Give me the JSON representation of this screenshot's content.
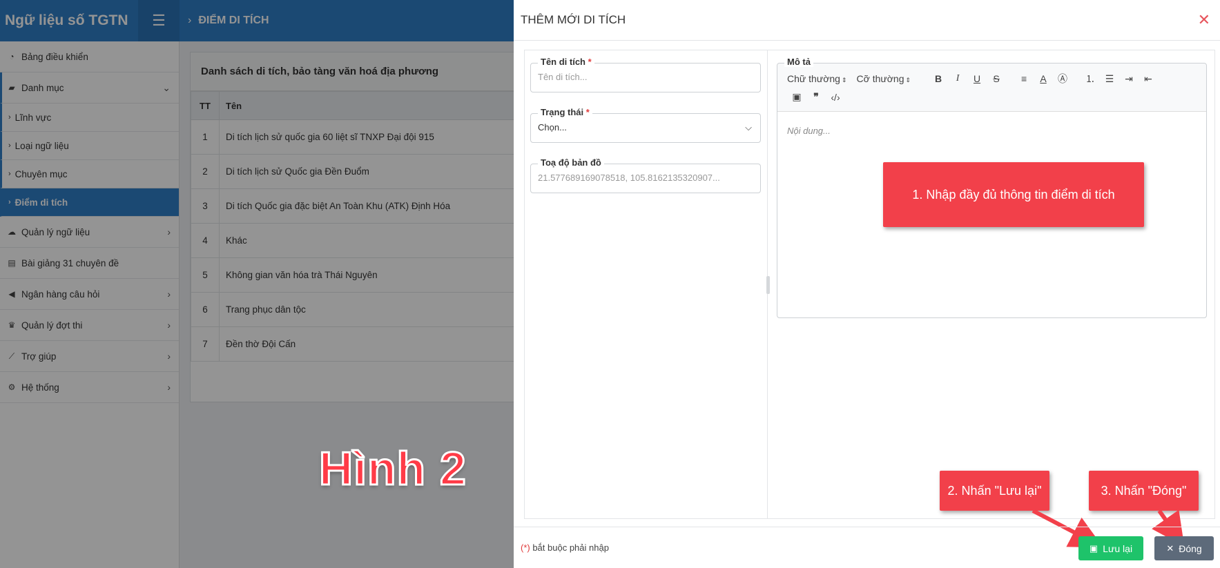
{
  "app": {
    "brand": "Ngữ liệu số TGTN",
    "page_title": "ĐIỂM DI TÍCH"
  },
  "sidebar": {
    "items": [
      {
        "label": "Bảng điều khiển",
        "icon": "dashboard-icon"
      },
      {
        "label": "Danh mục",
        "icon": "folder-open-icon"
      },
      {
        "label": "Lĩnh vực"
      },
      {
        "label": "Loại ngữ liệu"
      },
      {
        "label": "Chuyên mục"
      },
      {
        "label": "Điểm di tích"
      },
      {
        "label": "Quản lý ngữ liệu",
        "icon": "cloud-icon"
      },
      {
        "label": "Bài giảng 31 chuyên đề",
        "icon": "archive-icon"
      },
      {
        "label": "Ngân hàng câu hỏi",
        "icon": "bullhorn-icon"
      },
      {
        "label": "Quản lý đợt thi",
        "icon": "trophy-icon"
      },
      {
        "label": "Trợ giúp",
        "icon": "chart-line-icon"
      },
      {
        "label": "Hệ thống",
        "icon": "gears-icon"
      }
    ]
  },
  "list": {
    "title": "Danh sách di tích, bảo tàng văn hoá địa phương",
    "columns": [
      "TT",
      "Tên"
    ],
    "rows": [
      {
        "tt": "1",
        "name": "Di tích lịch sử quốc gia 60 liệt sĩ TNXP Đại đội 915"
      },
      {
        "tt": "2",
        "name": "Di tích lịch sử Quốc gia Đền Đuổm"
      },
      {
        "tt": "3",
        "name": "Di tích Quốc gia đặc biệt An Toàn Khu (ATK) Định Hóa"
      },
      {
        "tt": "4",
        "name": "Khác"
      },
      {
        "tt": "5",
        "name": "Không gian văn hóa trà Thái Nguyên"
      },
      {
        "tt": "6",
        "name": "Trang phục dân tộc"
      },
      {
        "tt": "7",
        "name": "Đền thờ Đội Cấn"
      }
    ]
  },
  "overlay_label": "Hình 2",
  "drawer": {
    "title": "THÊM MỚI DI TÍCH",
    "fields": {
      "name": {
        "label": "Tên di tích",
        "required": "*",
        "placeholder": "Tên di tích..."
      },
      "status": {
        "label": "Trạng thái",
        "required": "*",
        "value": "Chọn..."
      },
      "coords": {
        "label": "Toạ độ bản đồ",
        "value": "21.577689169078518, 105.8162135320907..."
      },
      "description": {
        "label": "Mô tả",
        "placeholder": "Nội dung..."
      }
    },
    "toolbar": {
      "style_select": "Chữ thường",
      "size_select": "Cỡ thường"
    },
    "footer_note_mark": "(*)",
    "footer_note": " bắt buộc phải nhập",
    "save_label": "Lưu lại",
    "close_label": "Đóng"
  },
  "callouts": {
    "step1": "1. Nhập đầy đủ thông tin điểm di tích",
    "step2": "2. Nhấn \"Lưu lại\"",
    "step3": "3. Nhấn \"Đóng\""
  },
  "colors": {
    "primary": "#2f7ec7",
    "callout": "#f2404a",
    "save": "#1ec36a",
    "close": "#5d6a7a",
    "required": "#e03a3a"
  }
}
